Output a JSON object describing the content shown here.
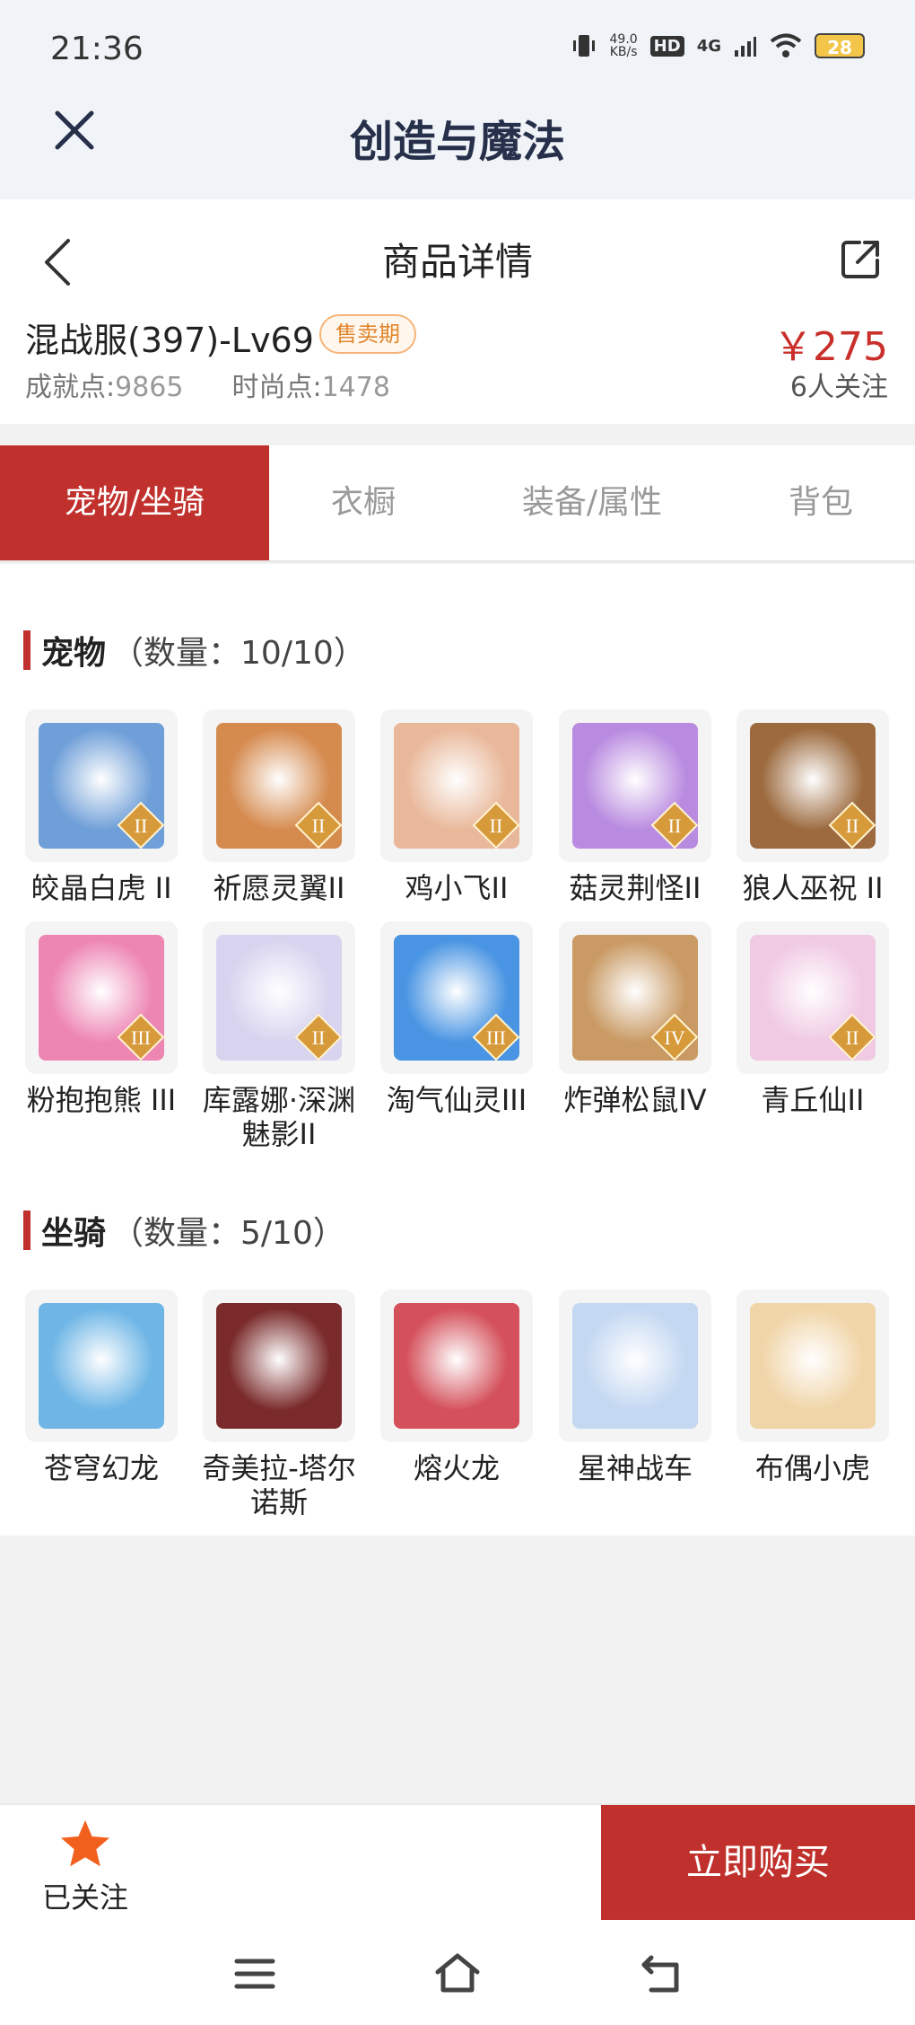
{
  "status_bar": {
    "time": "21:36",
    "speed_value": "49.0",
    "speed_unit": "KB/s",
    "hd": "HD",
    "network": "4G",
    "battery": "28"
  },
  "app": {
    "title": "创造与魔法"
  },
  "page": {
    "title": "商品详情"
  },
  "product": {
    "name": "混战服(397)-Lv69",
    "badge": "售卖期",
    "price": "￥275",
    "achievement_label": "成就点:",
    "achievement_value": "9865",
    "fashion_label": "时尚点:",
    "fashion_value": "1478",
    "followers": "6人关注"
  },
  "tabs": [
    {
      "label": "宠物/坐骑",
      "active": true
    },
    {
      "label": "衣橱",
      "active": false
    },
    {
      "label": "装备/属性",
      "active": false
    },
    {
      "label": "背包",
      "active": false
    }
  ],
  "pets": {
    "title": "宠物",
    "count": "（数量：10/10）",
    "items": [
      {
        "name": "皎晶白虎 II",
        "tier": "II",
        "color": "#6f9fd8"
      },
      {
        "name": "祈愿灵翼II",
        "tier": "II",
        "color": "#d58a4e"
      },
      {
        "name": "鸡小飞II",
        "tier": "II",
        "color": "#e9b89a"
      },
      {
        "name": "菇灵荆怪II",
        "tier": "II",
        "color": "#b98be0"
      },
      {
        "name": "狼人巫祝 II",
        "tier": "II",
        "color": "#9c6a3e"
      },
      {
        "name": "粉抱抱熊 III",
        "tier": "III",
        "color": "#ee86b4"
      },
      {
        "name": "库露娜·深渊魅影II",
        "tier": "II",
        "color": "#d8d4ef"
      },
      {
        "name": "淘气仙灵III",
        "tier": "III",
        "color": "#4a95e3"
      },
      {
        "name": "炸弹松鼠IV",
        "tier": "IV",
        "color": "#c99a64"
      },
      {
        "name": "青丘仙II",
        "tier": "II",
        "color": "#f0c9e3"
      }
    ]
  },
  "mounts": {
    "title": "坐骑",
    "count": "（数量：5/10）",
    "items": [
      {
        "name": "苍穹幻龙",
        "color": "#6fb6e6"
      },
      {
        "name": "奇美拉-塔尔诺斯",
        "color": "#7a2a2a"
      },
      {
        "name": "熔火龙",
        "color": "#d4505a"
      },
      {
        "name": "星神战车",
        "color": "#c4d8f2"
      },
      {
        "name": "布偶小虎",
        "color": "#f0d5a8"
      }
    ]
  },
  "bottom_bar": {
    "follow_label": "已关注",
    "buy_label": "立即购买"
  },
  "colors": {
    "accent": "#c0312d",
    "header_bg": "#f0f3f8",
    "badge": "#e0862c",
    "star": "#f2601e"
  }
}
